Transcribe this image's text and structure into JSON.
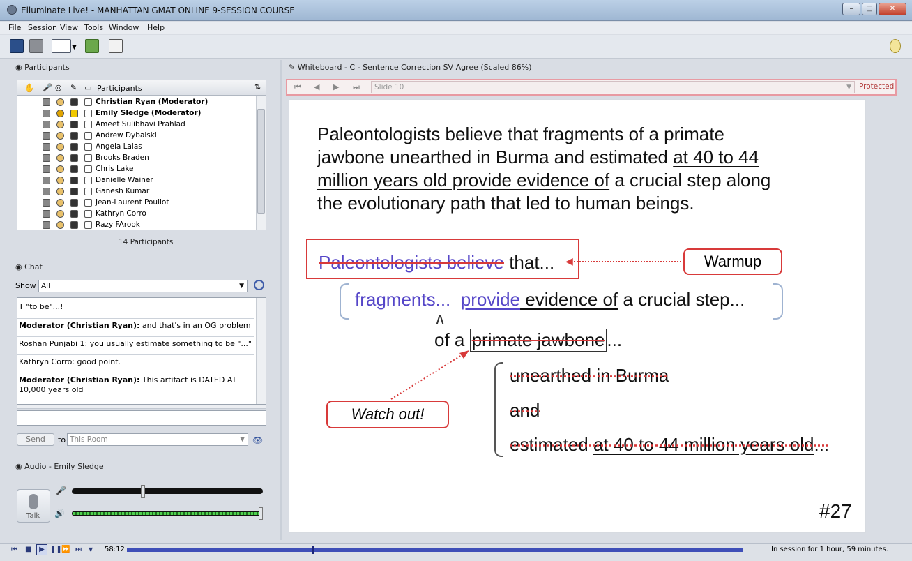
{
  "window": {
    "title": "Elluminate Live! - MANHATTAN GMAT ONLINE 9-SESSION COURSE"
  },
  "menu": [
    "File",
    "Session",
    "View",
    "Tools",
    "Window",
    "Help"
  ],
  "participants": {
    "section_title": "Participants",
    "column_header": "Participants",
    "count_label": "14 Participants",
    "rows": [
      {
        "name": "Christian Ryan (Moderator)",
        "bold": true
      },
      {
        "name": "Emily Sledge (Moderator)",
        "bold": true
      },
      {
        "name": "Ameet Sulibhavi Prahlad"
      },
      {
        "name": "Andrew Dybalski"
      },
      {
        "name": "Angela Lalas"
      },
      {
        "name": "Brooks Braden"
      },
      {
        "name": "Chris Lake"
      },
      {
        "name": "Danielle Wainer"
      },
      {
        "name": "Ganesh Kumar"
      },
      {
        "name": "Jean-Laurent Poullot"
      },
      {
        "name": "Kathryn Corro"
      },
      {
        "name": "Razy FArook"
      }
    ]
  },
  "chat": {
    "section_title": "Chat",
    "show_label": "Show",
    "show_value": "All",
    "messages": [
      {
        "text": "T \"to be\"...!"
      },
      {
        "speaker": "Moderator (Christian Ryan):",
        "text": " and that's in an OG problem"
      },
      {
        "text": "Roshan Punjabi 1: you usually estimate something to be \"...\""
      },
      {
        "text": "Kathryn Corro: good point."
      },
      {
        "speaker": "Moderator (Christian Ryan):",
        "text": " This artifact is DATED AT"
      },
      {
        "text": "10,000 years old"
      }
    ],
    "send_label": "Send",
    "to_label": "to",
    "to_value": "This Room"
  },
  "audio": {
    "section_title": "Audio - Emily Sledge",
    "talk_label": "Talk",
    "mic_level": 0.36,
    "speaker_level": 1.0
  },
  "whiteboard": {
    "title": "Whiteboard - C - Sentence Correction SV Agree (Scaled 86%)",
    "slide_label": "Slide 10",
    "protected_label": "Protected"
  },
  "slide": {
    "question": {
      "l1": "Paleontologists believe that fragments of a primate",
      "l2a": "jawbone unearthed in Burma and estimated ",
      "l2b": "at 40 to 44",
      "l3a": "million years old provide evidence of",
      "l3b": " a crucial step along",
      "l4": "the evolutionary path that led to human beings."
    },
    "boxed_a": "Paleontologists believe",
    "boxed_b": " that...",
    "warmup": "Warmup",
    "frag_a": "fragments...",
    "frag_b": "provide",
    "frag_c": " evidence of",
    "frag_d": " a crucial step...",
    "of_a": "of a ",
    "of_b": "primate jawbone",
    "of_c": "...",
    "watch_out": "Watch out!",
    "mod1": "unearthed in Burma",
    "mod2": "and",
    "mod3a": "estimated ",
    "mod3b": "at 40 to 44 million years old",
    "mod3c": "...",
    "number": "#27"
  },
  "status": {
    "time": "58:12",
    "session": "In session for 1 hour, 59 minutes.",
    "playback_fraction": 0.3
  }
}
